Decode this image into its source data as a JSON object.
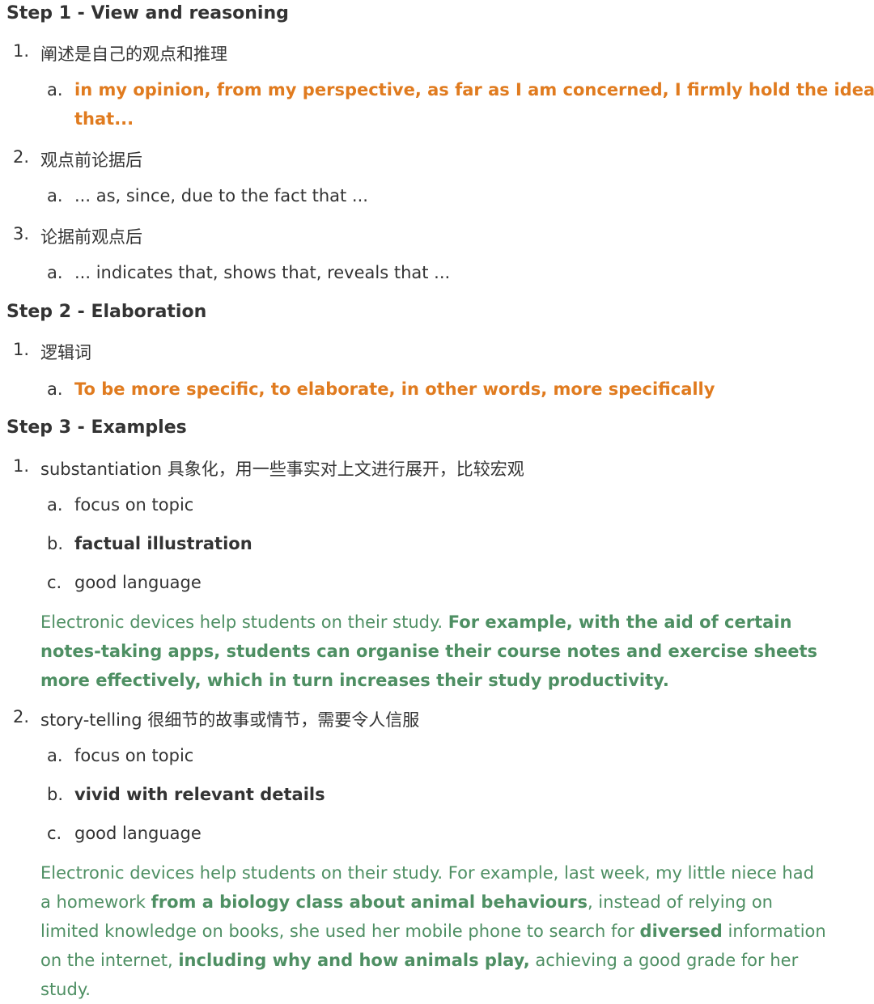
{
  "step1": {
    "heading": "Step 1 - View and reasoning",
    "items": [
      {
        "num": "1.",
        "text": "阐述是自己的观点和推理",
        "sub": [
          {
            "marker": "a.",
            "line1": "in my opinion, from my perspective, as far as I am concerned, I firmly hold the idea",
            "line2": "that..."
          }
        ]
      },
      {
        "num": "2.",
        "text": "观点前论据后",
        "sub": [
          {
            "marker": "a.",
            "text": "... as, since, due to the fact that ..."
          }
        ]
      },
      {
        "num": "3.",
        "text": "论据前观点后",
        "sub": [
          {
            "marker": "a.",
            "text": "... indicates that, shows that, reveals that ..."
          }
        ]
      }
    ]
  },
  "step2": {
    "heading": "Step 2 - Elaboration",
    "items": [
      {
        "num": "1.",
        "text": "逻辑词",
        "sub": [
          {
            "marker": "a.",
            "text": "To be more specific, to elaborate, in other words, more specifically"
          }
        ]
      }
    ]
  },
  "step3": {
    "heading": "Step 3 - Examples",
    "items": [
      {
        "num": "1.",
        "text": "substantiation 具象化，用一些事实对上文进行展开，比较宏观",
        "sub": [
          {
            "marker": "a.",
            "text": "focus on topic"
          },
          {
            "marker": "b.",
            "text": "factual illustration"
          },
          {
            "marker": "c.",
            "text": "good language"
          }
        ],
        "example": {
          "plain1": "Electronic devices help students on their study. ",
          "bold1": "For example, with the aid of certain notes-taking apps, students can organise their course notes and exercise sheets more effectively, which in turn increases their study productivity."
        }
      },
      {
        "num": "2.",
        "text": "story-telling 很细节的故事或情节，需要令人信服",
        "sub": [
          {
            "marker": "a.",
            "text": "focus on topic"
          },
          {
            "marker": "b.",
            "text": "vivid with relevant details"
          },
          {
            "marker": "c.",
            "text": "good language"
          }
        ],
        "example": {
          "p1": "Electronic devices help students on their study. For example, last week, my little niece had a homework ",
          "b1": "from a biology class about animal behaviours",
          "p2": ", instead of relying on limited knowledge on books, she used her mobile phone to search for ",
          "b2": "diversed",
          "p3": " information on the internet, ",
          "b3": "including why and how animals play,",
          "p4": " achieving a good grade for her study."
        }
      }
    ]
  },
  "colors": {
    "text": "#333333",
    "orange": "#e07b1f",
    "green": "#4e8f63"
  }
}
